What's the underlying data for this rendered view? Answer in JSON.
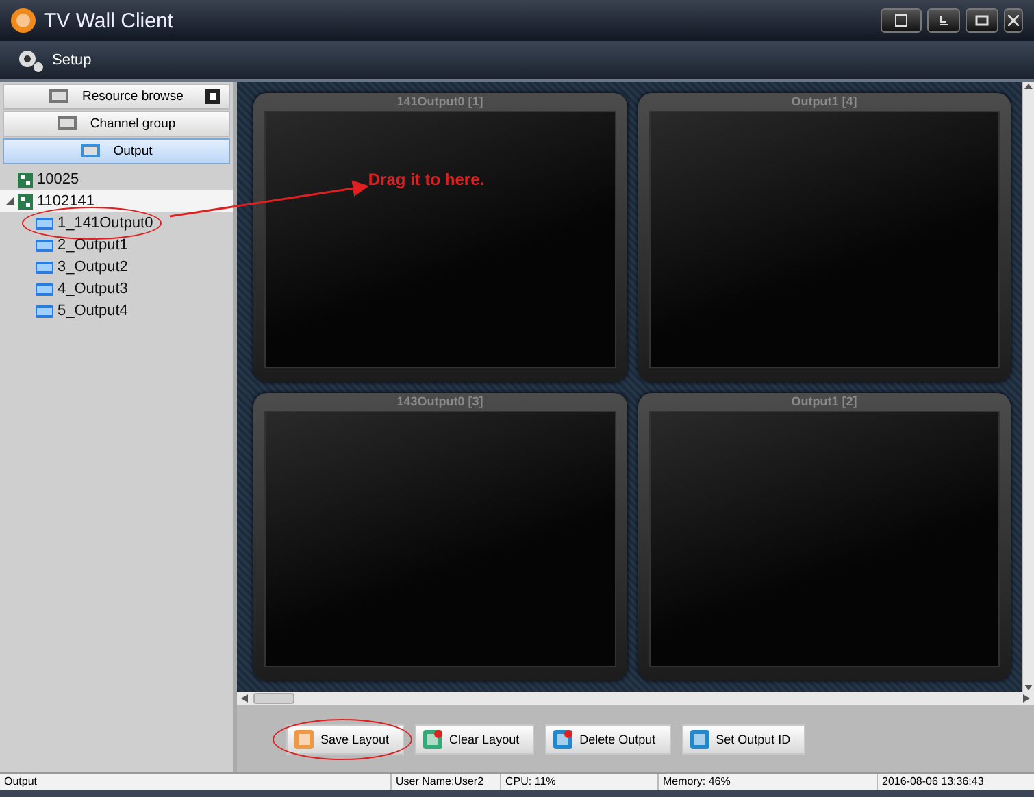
{
  "window": {
    "title": "TV Wall Client"
  },
  "toolbar": {
    "items": [
      {
        "label": "Setup"
      }
    ]
  },
  "sidebar": {
    "tabs": [
      {
        "label": "Resource browse",
        "selected": false
      },
      {
        "label": "Channel group",
        "selected": false
      },
      {
        "label": "Output",
        "selected": true
      }
    ],
    "tree": [
      {
        "label": "10025",
        "kind": "server"
      },
      {
        "label": "1102141",
        "kind": "server",
        "expanded": true,
        "selected": true,
        "children": [
          {
            "label": "1_141Output0",
            "kind": "output",
            "circled": true
          },
          {
            "label": "2_Output1",
            "kind": "output",
            "circled": false
          },
          {
            "label": "3_Output2",
            "kind": "output",
            "circled": false
          },
          {
            "label": "4_Output3",
            "kind": "output",
            "circled": false
          },
          {
            "label": "5_Output4",
            "kind": "output",
            "circled": false
          }
        ]
      }
    ]
  },
  "monitors": [
    {
      "title": "141Output0 [1]"
    },
    {
      "title": "Output1 [4]"
    },
    {
      "title": "143Output0 [3]"
    },
    {
      "title": "Output1 [2]"
    }
  ],
  "annotation": {
    "text": "Drag it to here."
  },
  "buttons": [
    {
      "label": "Save Layout",
      "kind": "save",
      "circled": true
    },
    {
      "label": "Clear Layout",
      "kind": "clear",
      "circled": false
    },
    {
      "label": "Delete Output",
      "kind": "delete",
      "circled": false
    },
    {
      "label": "Set Output ID",
      "kind": "id",
      "circled": false
    }
  ],
  "status_bar": {
    "items": [
      "Output",
      "User Name:User2",
      "CPU: 11%",
      "Memory: 46%",
      "2016-08-06 13:36:43"
    ]
  }
}
